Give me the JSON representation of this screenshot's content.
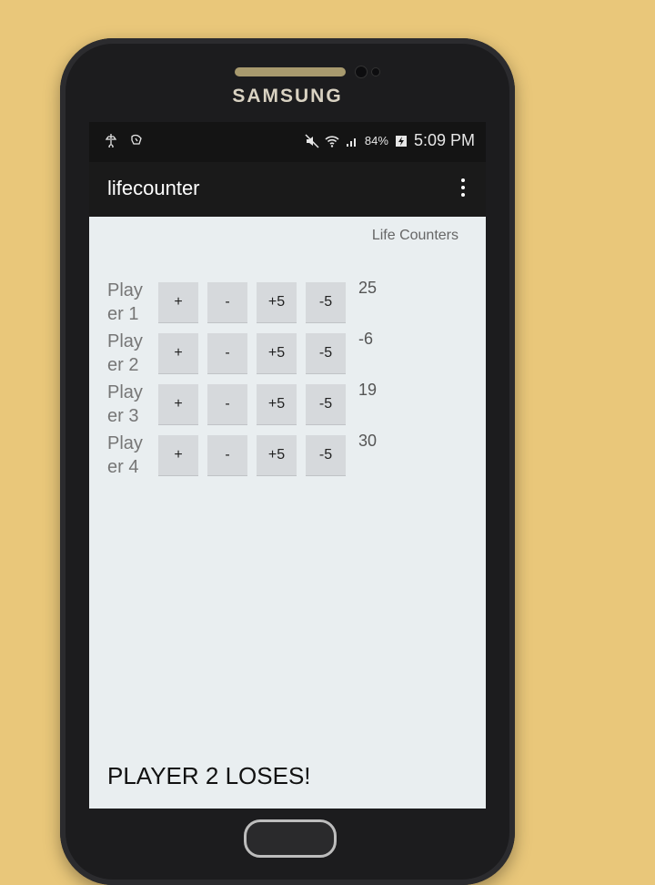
{
  "status": {
    "battery": "84%",
    "time": "5:09 PM",
    "icons": [
      "usb-icon",
      "debug-icon",
      "mute-icon",
      "wifi-icon",
      "signal-icon",
      "battery-icon"
    ]
  },
  "device": {
    "brand": "SAMSUNG"
  },
  "app": {
    "title": "lifecounter",
    "menu_icon": "overflow-menu-icon"
  },
  "main": {
    "section_title": "Life Counters",
    "players": [
      {
        "label": "Play er 1",
        "buttons": [
          "+",
          "-",
          "+5",
          "-5"
        ],
        "life": "25"
      },
      {
        "label": "Play er 2",
        "buttons": [
          "+",
          "-",
          "+5",
          "-5"
        ],
        "life": "-6"
      },
      {
        "label": "Play er 3",
        "buttons": [
          "+",
          "-",
          "+5",
          "-5"
        ],
        "life": "19"
      },
      {
        "label": "Play er 4",
        "buttons": [
          "+",
          "-",
          "+5",
          "-5"
        ],
        "life": "30"
      }
    ],
    "result": "PLAYER 2 LOSES!"
  },
  "colors": {
    "screen_background": "#e9eef0",
    "actionbar": "#1a1a1a",
    "button": "#d6d9dc"
  }
}
